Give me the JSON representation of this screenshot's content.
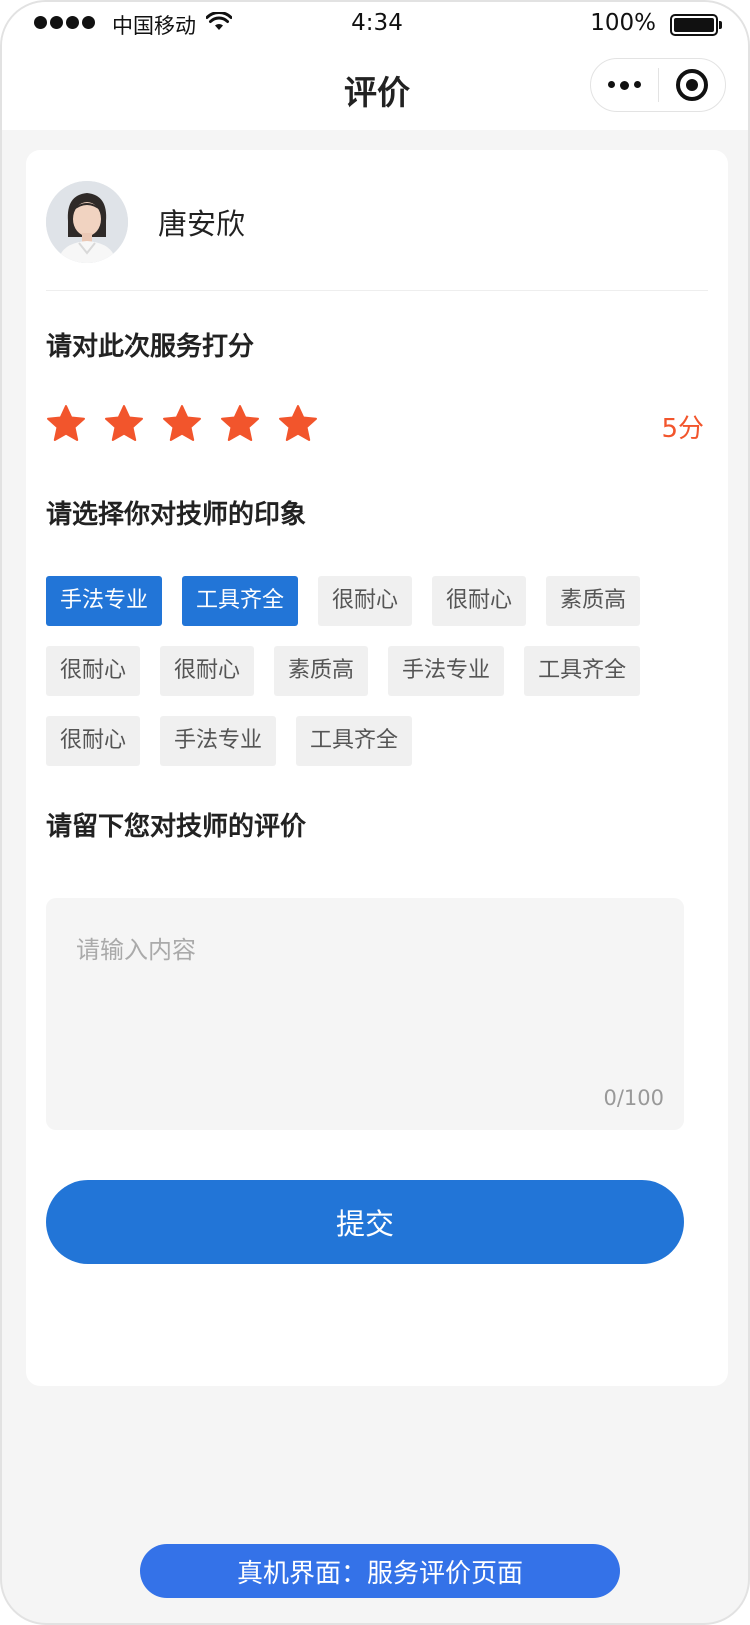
{
  "status_bar": {
    "carrier": "中国移动",
    "time": "4:34",
    "battery": "100%"
  },
  "nav": {
    "title": "评价"
  },
  "technician": {
    "name": "唐安欣"
  },
  "rating": {
    "title": "请对此次服务打分",
    "stars": 5,
    "max_stars": 5,
    "score_label": "5分",
    "star_color": "#f2552c"
  },
  "impression": {
    "title": "请选择你对技师的印象",
    "tag_rows": [
      [
        {
          "label": "手法专业",
          "selected": true
        },
        {
          "label": "工具齐全",
          "selected": true
        },
        {
          "label": "很耐心",
          "selected": false
        },
        {
          "label": "很耐心",
          "selected": false
        },
        {
          "label": "素质高",
          "selected": false
        }
      ],
      [
        {
          "label": "很耐心",
          "selected": false
        },
        {
          "label": "很耐心",
          "selected": false
        },
        {
          "label": "素质高",
          "selected": false
        },
        {
          "label": "手法专业",
          "selected": false
        },
        {
          "label": "工具齐全",
          "selected": false
        }
      ],
      [
        {
          "label": "很耐心",
          "selected": false
        },
        {
          "label": "手法专业",
          "selected": false
        },
        {
          "label": "工具齐全",
          "selected": false
        }
      ]
    ]
  },
  "comment": {
    "title": "请留下您对技师的评价",
    "placeholder": "请输入内容",
    "value": "",
    "counter": "0/100"
  },
  "submit": {
    "label": "提交"
  },
  "caption": {
    "label": "真机界面：服务评价页面"
  },
  "colors": {
    "primary": "#2275d7",
    "accent": "#f2552c",
    "caption_bg": "#3472e8"
  }
}
